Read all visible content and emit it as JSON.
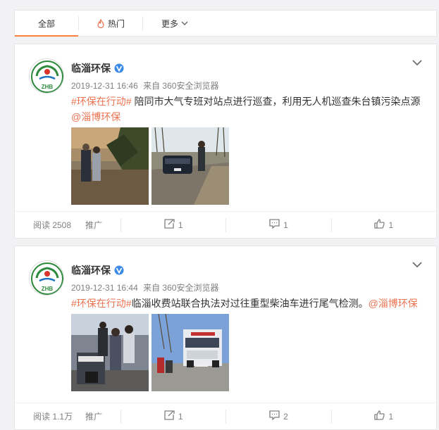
{
  "tabs": [
    {
      "label": "全部",
      "icon": null
    },
    {
      "label": "热门",
      "icon": "flame-icon"
    },
    {
      "label": "更多",
      "icon": "chevron-down-icon"
    }
  ],
  "accent": "#ff8140",
  "link_color": "#eb7350",
  "avatar_text": "ZHB",
  "posts": [
    {
      "author": "临淄环保",
      "date": "2019-12-31 16:46",
      "source": "来自 360安全浏览器",
      "topic": "#环保在行动#",
      "body": " 陪同市大气专班对站点进行巡查，利用无人机巡查朱台镇污染点源",
      "mention": "@淄博环保",
      "reads": "阅读 2508",
      "promo": "推广",
      "reposts": "1",
      "comments": "1",
      "likes": "1"
    },
    {
      "author": "临淄环保",
      "date": "2019-12-31 16:44",
      "source": "来自 360安全浏览器",
      "topic": "#环保在行动#",
      "body": "临淄收费站联合执法对过往重型柴油车进行尾气检测。",
      "mention": "@淄博环保",
      "reads": "阅读 1.1万",
      "promo": "推广",
      "reposts": "1",
      "comments": "2",
      "likes": "1"
    }
  ]
}
